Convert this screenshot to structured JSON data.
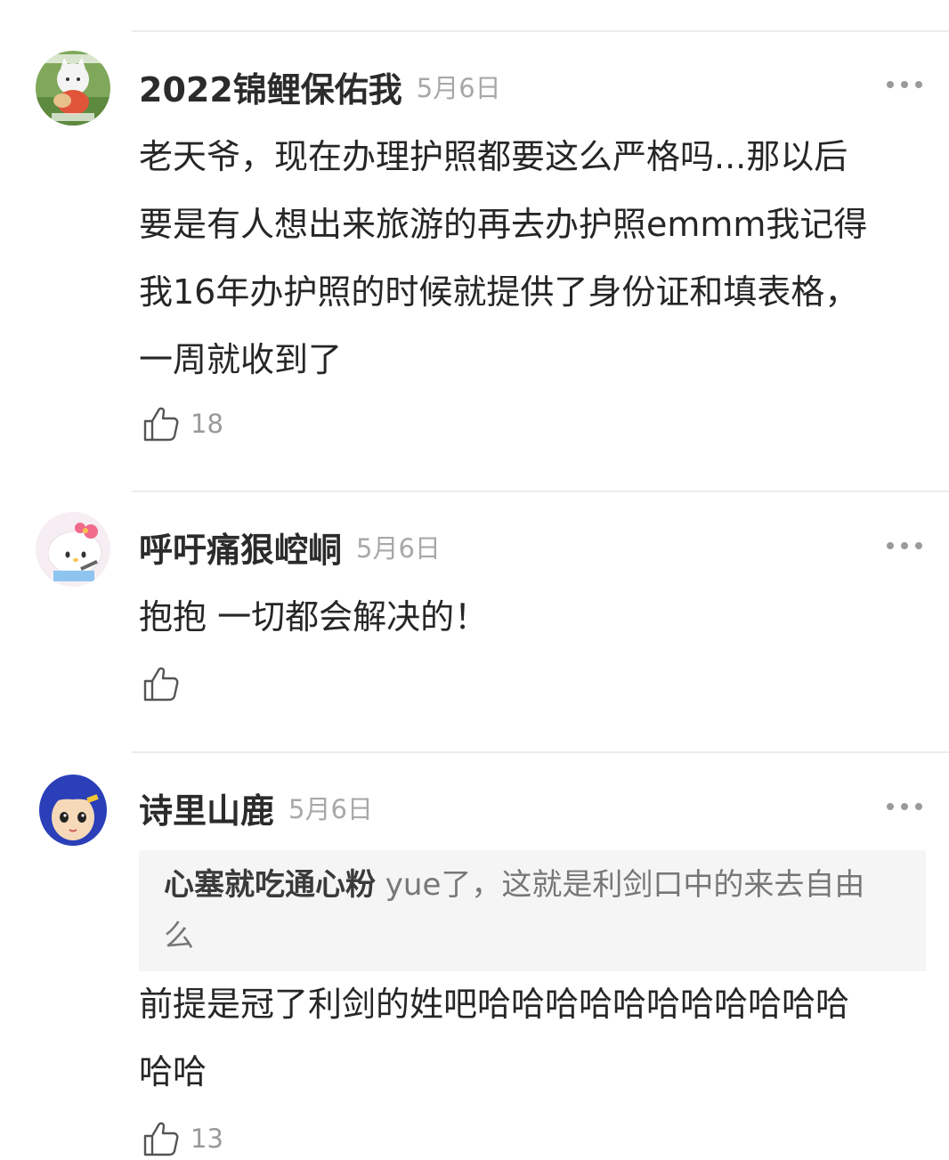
{
  "comments": [
    {
      "username": "2022锦鲤保佑我",
      "date": "5月6日",
      "text": "老天爷，现在办理护照都要这么严格吗...那以后\n要是有人想出来旅游的再去办护照emmm我记得\n我16年办护照的时候就提供了身份证和填表格，\n一周就收到了",
      "likes": "18",
      "avatar_icon": "cartoon-animal-avatar"
    },
    {
      "username": "呼吁痛狠崆峒",
      "date": "5月6日",
      "text": "抱抱 一切都会解决的！",
      "likes": "",
      "avatar_icon": "hello-kitty-avatar"
    },
    {
      "username": "诗里山鹿",
      "date": "5月6日",
      "quote_author": "心塞就吃通心粉",
      "quote_text": " yue了，这就是利剑口中的来去自由\n么",
      "text": "前提是冠了利剑的姓吧哈哈哈哈哈哈哈哈哈哈哈\n哈哈",
      "likes": "13",
      "avatar_icon": "blue-hair-cartoon-avatar"
    }
  ],
  "colors": {
    "username": "#2b2b2b",
    "date": "#a8a8a8",
    "body": "#262626",
    "quote_bg": "#f5f5f5",
    "divider": "#ececec"
  },
  "icons": {
    "like": "thumbs-up-icon",
    "more": "more-dots-icon"
  }
}
